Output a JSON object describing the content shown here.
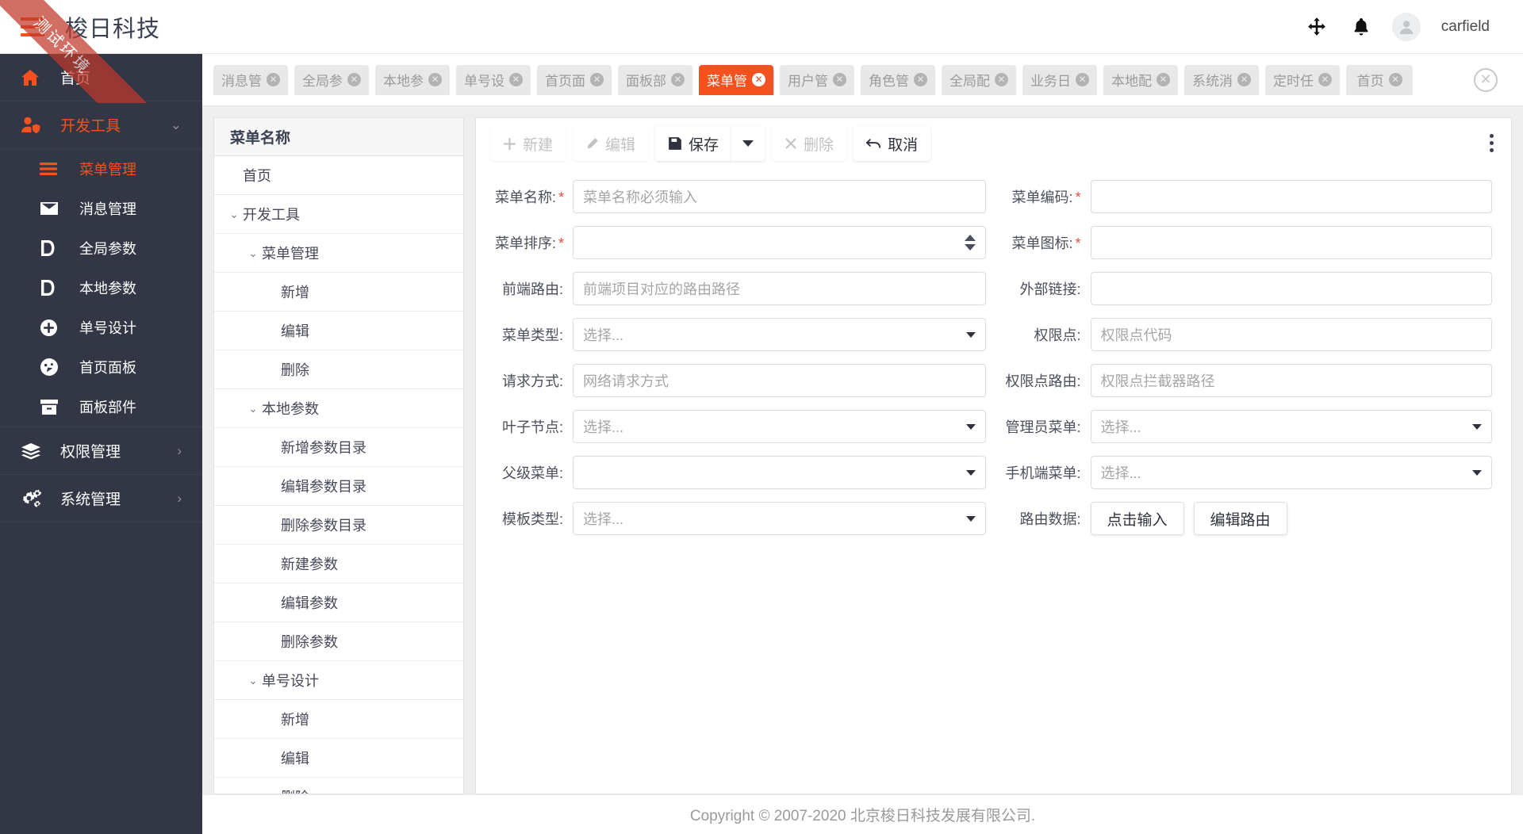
{
  "header": {
    "brand": "梭日科技",
    "menu_icon": "hamburger-icon",
    "move_icon": "move-arrows-icon",
    "bell_icon": "bell-icon",
    "username": "carfield"
  },
  "ribbon": {
    "text": "测试环境"
  },
  "sidebar": {
    "home": {
      "label": "首页",
      "icon": "home-icon"
    },
    "group": {
      "label": "开发工具",
      "icon": "user-shield-icon",
      "caret": "⌄"
    },
    "items": [
      {
        "label": "菜单管理",
        "icon": "menu-lines-icon",
        "active": true
      },
      {
        "label": "消息管理",
        "icon": "envelope-icon",
        "active": false
      },
      {
        "label": "全局参数",
        "icon": "document-icon",
        "active": false
      },
      {
        "label": "本地参数",
        "icon": "document-icon",
        "active": false
      },
      {
        "label": "单号设计",
        "icon": "plus-circle-icon",
        "active": false
      },
      {
        "label": "首页面板",
        "icon": "gauge-icon",
        "active": false
      },
      {
        "label": "面板部件",
        "icon": "box-icon",
        "active": false
      }
    ],
    "groups_collapsed": [
      {
        "label": "权限管理",
        "icon": "layers-icon",
        "caret": "›"
      },
      {
        "label": "系统管理",
        "icon": "gears-icon",
        "caret": "›"
      }
    ]
  },
  "tabs": {
    "items": [
      {
        "label": "消息管",
        "active": false
      },
      {
        "label": "全局参",
        "active": false
      },
      {
        "label": "本地参",
        "active": false
      },
      {
        "label": "单号设",
        "active": false
      },
      {
        "label": "首页面",
        "active": false
      },
      {
        "label": "面板部",
        "active": false
      },
      {
        "label": "菜单管",
        "active": true
      },
      {
        "label": "用户管",
        "active": false
      },
      {
        "label": "角色管",
        "active": false
      },
      {
        "label": "全局配",
        "active": false
      },
      {
        "label": "业务日",
        "active": false
      },
      {
        "label": "本地配",
        "active": false
      },
      {
        "label": "系统消",
        "active": false
      },
      {
        "label": "定时任",
        "active": false
      },
      {
        "label": "首页",
        "active": false
      }
    ],
    "close_all_icon": "close-circle-icon"
  },
  "tree": {
    "header": "菜单名称",
    "rows": [
      {
        "label": "首页",
        "indent": 1,
        "chevron": ""
      },
      {
        "label": "开发工具",
        "indent": 1,
        "chevron": "⌄"
      },
      {
        "label": "菜单管理",
        "indent": 2,
        "chevron": "⌄"
      },
      {
        "label": "新增",
        "indent": 3,
        "chevron": ""
      },
      {
        "label": "编辑",
        "indent": 3,
        "chevron": ""
      },
      {
        "label": "删除",
        "indent": 3,
        "chevron": ""
      },
      {
        "label": "本地参数",
        "indent": 2,
        "chevron": "⌄"
      },
      {
        "label": "新增参数目录",
        "indent": 3,
        "chevron": ""
      },
      {
        "label": "编辑参数目录",
        "indent": 3,
        "chevron": ""
      },
      {
        "label": "删除参数目录",
        "indent": 3,
        "chevron": ""
      },
      {
        "label": "新建参数",
        "indent": 3,
        "chevron": ""
      },
      {
        "label": "编辑参数",
        "indent": 3,
        "chevron": ""
      },
      {
        "label": "删除参数",
        "indent": 3,
        "chevron": ""
      },
      {
        "label": "单号设计",
        "indent": 2,
        "chevron": "⌄"
      },
      {
        "label": "新增",
        "indent": 3,
        "chevron": ""
      },
      {
        "label": "编辑",
        "indent": 3,
        "chevron": ""
      },
      {
        "label": "删除",
        "indent": 3,
        "chevron": ""
      }
    ]
  },
  "toolbar": {
    "new_label": "新建",
    "edit_label": "编辑",
    "save_label": "保存",
    "delete_label": "删除",
    "cancel_label": "取消",
    "new_icon": "plus-icon",
    "edit_icon": "pencil-icon",
    "save_icon": "floppy-disk-icon",
    "save_caret_icon": "caret-down-icon",
    "delete_icon": "times-icon",
    "cancel_icon": "undo-arrow-icon",
    "more_icon": "kebab-menu-icon"
  },
  "form": {
    "left": [
      {
        "label": "菜单名称:",
        "required": true,
        "type": "input",
        "value": "",
        "placeholder": "菜单名称必须输入"
      },
      {
        "label": "菜单排序:",
        "required": true,
        "type": "spinner",
        "value": "",
        "placeholder": ""
      },
      {
        "label": "前端路由:",
        "required": false,
        "type": "input",
        "value": "",
        "placeholder": "前端项目对应的路由路径"
      },
      {
        "label": "菜单类型:",
        "required": false,
        "type": "select",
        "value": "",
        "placeholder": "选择..."
      },
      {
        "label": "请求方式:",
        "required": false,
        "type": "input",
        "value": "",
        "placeholder": "网络请求方式"
      },
      {
        "label": "叶子节点:",
        "required": false,
        "type": "select",
        "value": "",
        "placeholder": "选择..."
      },
      {
        "label": "父级菜单:",
        "required": false,
        "type": "select",
        "value": "",
        "placeholder": ""
      },
      {
        "label": "模板类型:",
        "required": false,
        "type": "select",
        "value": "",
        "placeholder": "选择..."
      }
    ],
    "right": [
      {
        "label": "菜单编码:",
        "required": true,
        "type": "input",
        "value": "",
        "placeholder": ""
      },
      {
        "label": "菜单图标:",
        "required": true,
        "type": "input",
        "value": "",
        "placeholder": ""
      },
      {
        "label": "外部链接:",
        "required": false,
        "type": "input",
        "value": "",
        "placeholder": ""
      },
      {
        "label": "权限点:",
        "required": false,
        "type": "input",
        "value": "",
        "placeholder": "权限点代码"
      },
      {
        "label": "权限点路由:",
        "required": false,
        "type": "input",
        "value": "",
        "placeholder": "权限点拦截器路径"
      },
      {
        "label": "管理员菜单:",
        "required": false,
        "type": "select",
        "value": "",
        "placeholder": "选择..."
      },
      {
        "label": "手机端菜单:",
        "required": false,
        "type": "select",
        "value": "",
        "placeholder": "选择..."
      },
      {
        "label": "路由数据:",
        "required": false,
        "type": "buttons",
        "buttons": [
          "点击输入",
          "编辑路由"
        ]
      }
    ]
  },
  "footer": {
    "text": "Copyright © 2007-2020 北京梭日科技发展有限公司."
  },
  "colors": {
    "accent": "#f4511e",
    "sidebar_bg": "#333645",
    "header_bg": "#ffffff",
    "workspace_bg": "#eeeeee",
    "required_star": "#e74c3c",
    "ribbon_bg": "#c0392b"
  }
}
